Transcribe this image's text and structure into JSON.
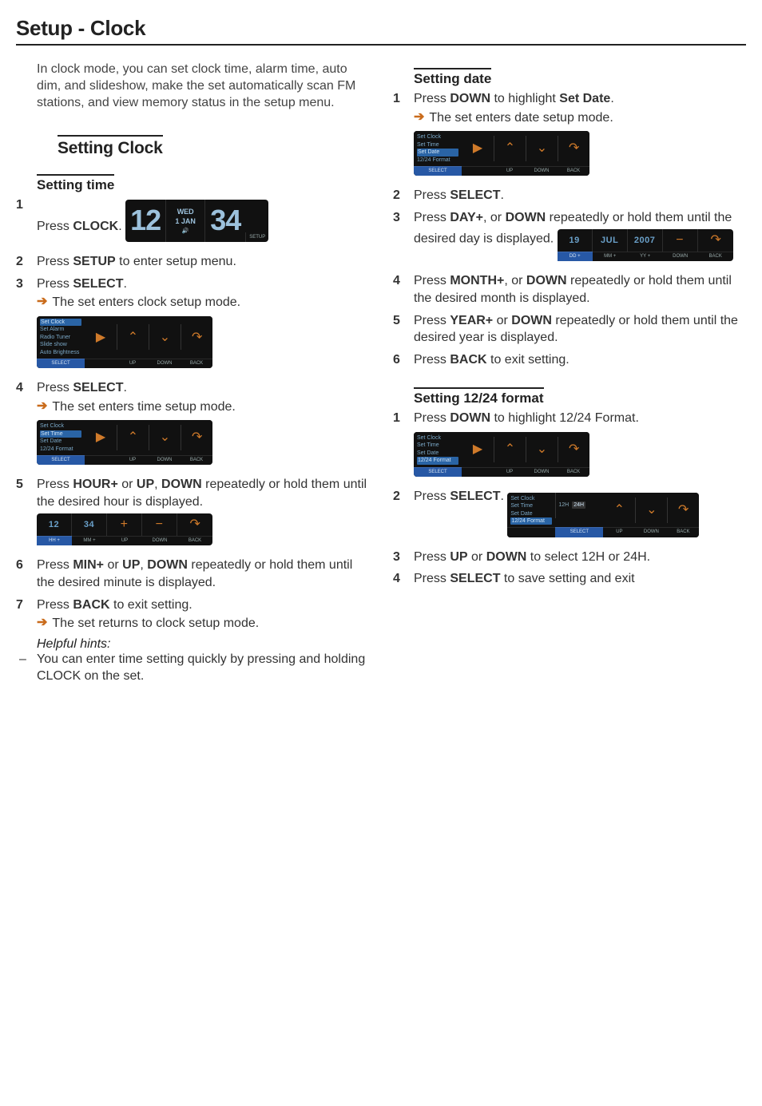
{
  "title": "Setup - Clock",
  "intro": "In clock mode, you can set clock time, alarm time, auto dim, and slideshow, make the set automatically scan FM stations, and view memory status in the setup menu.",
  "section_clock": "Setting Clock",
  "sub_time": "Setting time",
  "sub_date": "Setting date",
  "sub_1224": "Setting 12/24 format",
  "time_steps": [
    {
      "n": "1",
      "t_pre": "Press ",
      "b1": "CLOCK",
      "t_post": "."
    },
    {
      "n": "2",
      "t_pre": "Press ",
      "b1": "SETUP",
      "t_post": " to enter setup menu."
    },
    {
      "n": "3",
      "t_pre": "Press ",
      "b1": "SELECT",
      "t_post": ".",
      "result": "The set enters clock setup mode."
    },
    {
      "n": "4",
      "t_pre": "Press ",
      "b1": "SELECT",
      "t_post": ".",
      "result": "The set enters time setup mode."
    },
    {
      "n": "5",
      "t_pre": "Press ",
      "b1": "HOUR+",
      "t_mid": " or ",
      "b2": "UP",
      "t_mid2": ", ",
      "b3": "DOWN",
      "t_post": " repeatedly or hold them until the desired hour is displayed."
    },
    {
      "n": "6",
      "t_pre": "Press ",
      "b1": "MIN+",
      "t_mid": " or ",
      "b2": "UP",
      "t_mid2": ", ",
      "b3": "DOWN",
      "t_post": " repeatedly or hold them until the desired minute is displayed."
    },
    {
      "n": "7",
      "t_pre": "Press ",
      "b1": "BACK",
      "t_post": " to exit setting.",
      "result": "The set returns to clock setup mode."
    }
  ],
  "hints_title": "Helpful hints:",
  "hints": [
    "You can enter time setting quickly by pressing and holding CLOCK on the set."
  ],
  "date_steps": [
    {
      "n": "1",
      "t_pre": "Press ",
      "b1": "DOWN",
      "t_mid": " to highlight ",
      "b2": "Set Date",
      "t_post": ".",
      "result": "The set enters date setup mode."
    },
    {
      "n": "2",
      "t_pre": "Press ",
      "b1": "SELECT",
      "t_post": "."
    },
    {
      "n": "3",
      "t_pre": "Press ",
      "b1": "DAY+",
      "t_mid": ", or ",
      "b2": "DOWN",
      "t_post": " repeatedly or hold them until the desired day is displayed."
    },
    {
      "n": "4",
      "t_pre": "Press ",
      "b1": "MONTH+",
      "t_mid": ", or ",
      "b2": "DOWN",
      "t_post": " repeatedly or hold them until the desired month is displayed."
    },
    {
      "n": "5",
      "t_pre": "Press ",
      "b1": "YEAR+",
      "t_mid": " or ",
      "b2": "DOWN",
      "t_post": " repeatedly or hold them until the desired year is displayed."
    },
    {
      "n": "6",
      "t_pre": "Press ",
      "b1": "BACK",
      "t_post": " to exit setting."
    }
  ],
  "fmt_steps": [
    {
      "n": "1",
      "t_pre": "Press ",
      "b1": "DOWN",
      "t_post": " to highlight 12/24 Format."
    },
    {
      "n": "2",
      "t_pre": "Press ",
      "b1": "SELECT",
      "t_post": "."
    },
    {
      "n": "3",
      "t_pre": "Press ",
      "b1": "UP",
      "t_mid": " or ",
      "b2": "DOWN",
      "t_post": " to select 12H or 24H."
    },
    {
      "n": "4",
      "t_pre": "Press ",
      "b1": "SELECT",
      "t_post": " to save setting and exit"
    }
  ],
  "clock_big": {
    "h": "12",
    "m": "34",
    "day": "WED",
    "date": "1 JAN",
    "setup": "SETUP"
  },
  "menu": {
    "items": [
      "Set Clock",
      "Set Alarm",
      "Radio Tuner",
      "Slide show",
      "Auto Brightness"
    ],
    "labels": [
      "SELECT",
      "UP",
      "DOWN",
      "BACK"
    ]
  },
  "menu_time": {
    "items": [
      "Set Clock",
      "Set Time",
      "Set Date",
      "12/24 Format"
    ],
    "labels": [
      "SELECT",
      "UP",
      "DOWN",
      "BACK"
    ],
    "hl": 1
  },
  "menu_date": {
    "items": [
      "Set Clock",
      "Set Time",
      "Set Date",
      "12/24 Format"
    ],
    "labels": [
      "SELECT",
      "UP",
      "DOWN",
      "BACK"
    ],
    "hl": 2
  },
  "menu_1224": {
    "items": [
      "Set Clock",
      "Set Time",
      "Set Date",
      "12/24 Format"
    ],
    "labels": [
      "SELECT",
      "UP",
      "DOWN",
      "BACK"
    ],
    "hl": 3
  },
  "menu_1224_sel": {
    "items": [
      "Set Clock",
      "Set Time",
      "Set Date",
      "12/24 Format"
    ],
    "labels": [
      "SELECT",
      "UP",
      "DOWN",
      "BACK"
    ],
    "preview": [
      "12H",
      "24H"
    ]
  },
  "hourrow": {
    "vals": [
      "12",
      "34",
      "+",
      "−"
    ],
    "labels": [
      "HH +",
      "MM +",
      "UP",
      "DOWN",
      "BACK"
    ]
  },
  "daterow": {
    "vals": [
      "19",
      "JUL",
      "2007",
      "−"
    ],
    "labels": [
      "DD +",
      "MM +",
      "YY +",
      "DOWN",
      "BACK"
    ]
  }
}
